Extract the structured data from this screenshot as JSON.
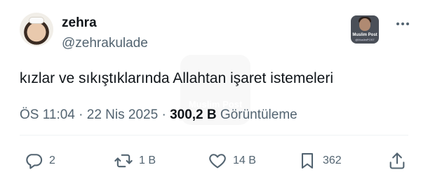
{
  "author": {
    "display_name": "zehra",
    "handle": "@zehrakulade"
  },
  "brand_badge": {
    "logo_text": "Muslim Post",
    "logo_sub": "@MuslimPOST"
  },
  "watermark": {
    "text": "Muslim Post"
  },
  "tweet": {
    "text": "kızlar ve sıkıştıklarında Allahtan işaret istemeleri",
    "time": "ÖS 11:04",
    "separator": "·",
    "date": "22 Nis 2025",
    "views_count": "300,2 B",
    "views_label": "Görüntüleme"
  },
  "actions": {
    "reply_count": "2",
    "retweet_count": "1 B",
    "like_count": "14 B",
    "bookmark_count": "362"
  },
  "colors": {
    "text": "#0f1419",
    "muted": "#536471",
    "divider": "#eff3f4"
  },
  "icons": [
    "more-icon",
    "reply-icon",
    "retweet-icon",
    "like-icon",
    "bookmark-icon",
    "share-icon"
  ]
}
